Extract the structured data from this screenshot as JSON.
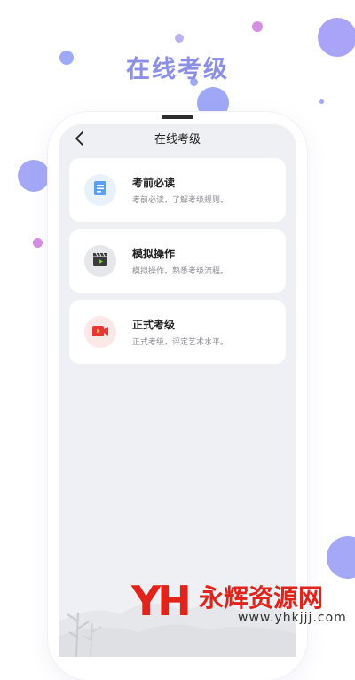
{
  "banner": {
    "title": "在线考级"
  },
  "nav": {
    "title": "在线考级",
    "back_icon": "chevron-left-icon"
  },
  "cards": [
    {
      "title": "考前必读",
      "subtitle": "考前必读，了解考级规则。",
      "icon": "document-icon",
      "icon_bg": "#e9f1fd",
      "icon_color": "#5b9ff0"
    },
    {
      "title": "模拟操作",
      "subtitle": "模拟操作，熟悉考级流程。",
      "icon": "clapperboard-icon",
      "icon_bg": "#e6e7ea",
      "icon_color": "#333333"
    },
    {
      "title": "正式考级",
      "subtitle": "正式考级，评定艺术水平。",
      "icon": "video-camera-icon",
      "icon_bg": "#fde8e8",
      "icon_color": "#e53935"
    }
  ],
  "watermark": {
    "logo": "YH",
    "name": "永辉资源网",
    "url": "www.yhkjjj.com"
  },
  "colors": {
    "accent": "#8b8fe6",
    "background": "#eff0f3"
  }
}
